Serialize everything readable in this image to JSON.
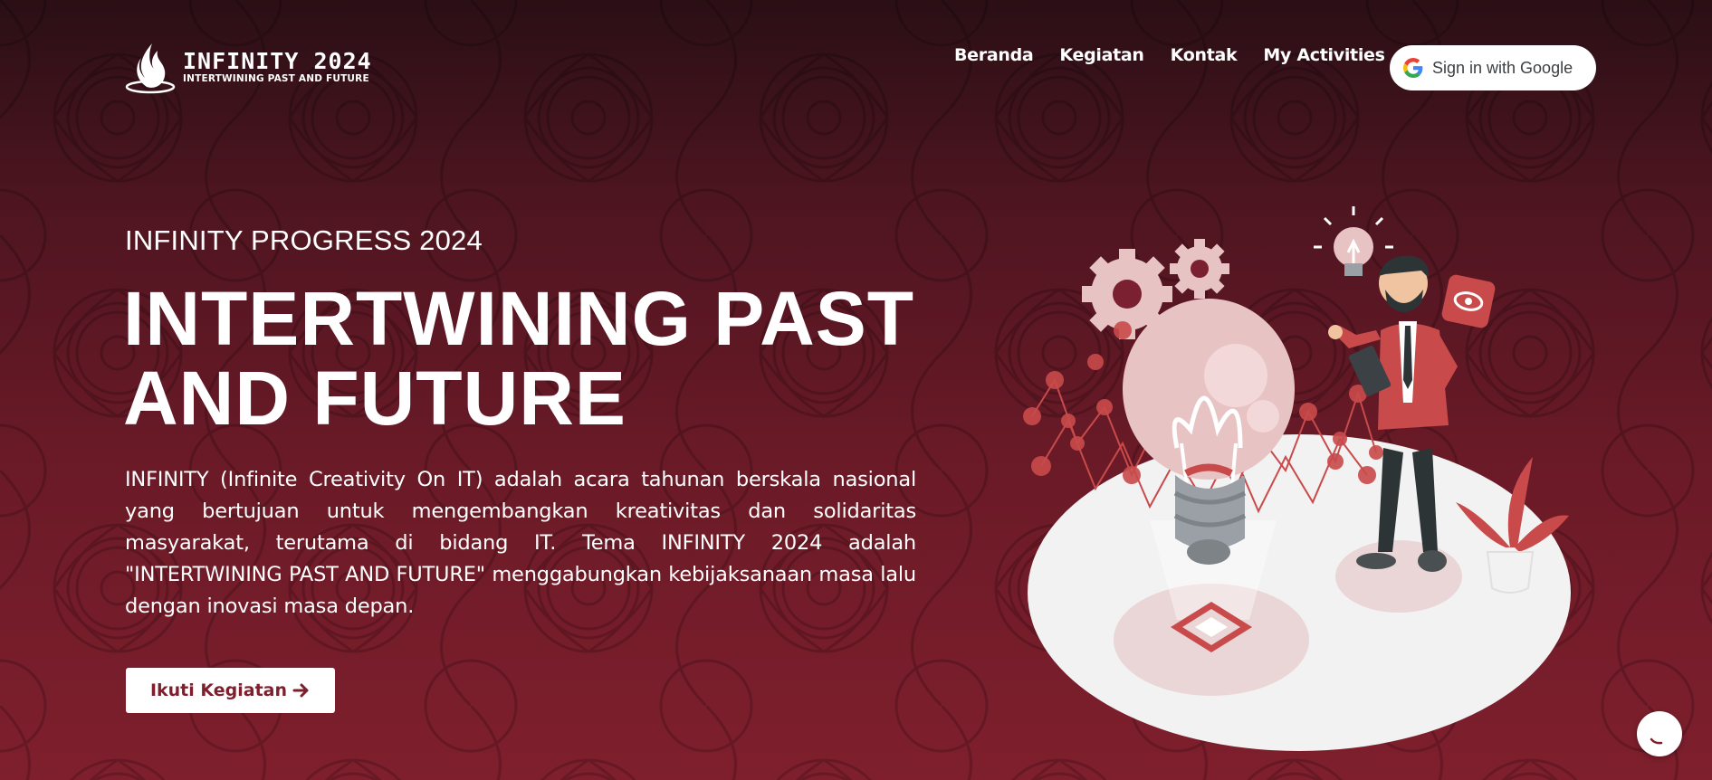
{
  "brand": {
    "title": "INFINITY 2024",
    "subtitle": "INTERTWINING PAST AND FUTURE"
  },
  "nav": {
    "items": [
      {
        "label": "Beranda"
      },
      {
        "label": "Kegiatan"
      },
      {
        "label": "Kontak"
      },
      {
        "label": "My Activities"
      }
    ],
    "signin_label": "Sign in with Google"
  },
  "hero": {
    "eyebrow": "INFINITY PROGRESS 2024",
    "headline_line1": "INTERTWINING PAST",
    "headline_line2": "AND FUTURE",
    "description": "INFINITY (Infinite Creativity On IT) adalah acara tahunan berskala nasional yang bertujuan untuk mengembangkan kreativitas dan solidaritas masyarakat, terutama di bidang IT. Tema INFINITY 2024 adalah \"INTERTWINING PAST AND FUTURE\" menggabungkan kebijaksanaan masa lalu dengan inovasi masa depan.",
    "cta_label": "Ikuti Kegiatan",
    "cta_icon": "arrow-right-icon"
  },
  "colors": {
    "background_top": "#2a0f15",
    "background_bottom": "#7f1f2d",
    "accent": "#7f1f2d",
    "illustration_red": "#c94a4a",
    "illustration_pink": "#e8c3c3"
  },
  "widgets": {
    "chat_icon": "chat-bubble-icon"
  }
}
